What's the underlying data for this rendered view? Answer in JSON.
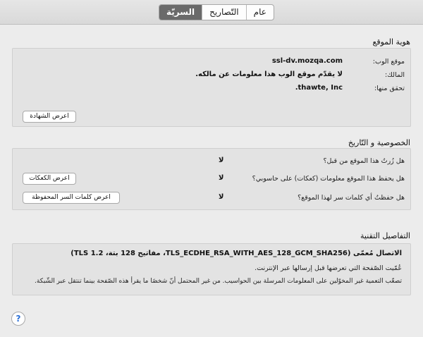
{
  "tabs": [
    "عام",
    "التّصاريح",
    "السريّة"
  ],
  "active_tab": "السريّة",
  "identity": {
    "title": "هوية الموقع",
    "website_label": "موقع الوب:",
    "website_value": "ssl-dv.mozqa.com",
    "owner_label": "المالك:",
    "owner_value": "لا  يقدّم موقع الوب هذا معلومات عن مالكه.",
    "verified_label": "تحقق منها:",
    "verified_value": "thawte, Inc.",
    "view_cert_button": "اعرض الشهادة"
  },
  "privacy": {
    "title": "الخصوصية و التّاريخ",
    "q1": "هل زُرتُ هذا الموقع من قبل؟",
    "a1": "لا",
    "q2": "هل يحفظ هذا الموقع معلومات (كعكات) على حاسوبي؟",
    "a2": "لا",
    "cookies_button": "اعرض الكعكات",
    "q3": "هل حفظتُ أي كلمات سر لهذا الموقع؟",
    "a3": "لا",
    "passwords_button": "اعرض كلمات السر المحفوظة"
  },
  "technical": {
    "title": "التفاصيل التقنية",
    "line1": "الاتصال مُعمّى (TLS_ECDHE_RSA_WITH_AES_128_GCM_SHA256، مفاتيح 128 بتة، TLS 1.2)",
    "line2": "عُمّيت الصّفحة التي تعرضها قبل إرسالها عبر الإنترنت.",
    "line3": "تصعّب التعمية غير المخوّلين  على المعلومات المرسلة بين  الحواسيب. من غير المحتمل أنّ شخصًا ما يقرأ هذه الصّفحة بينما تنتقل عبر الشّبكة."
  },
  "help_label": "?"
}
